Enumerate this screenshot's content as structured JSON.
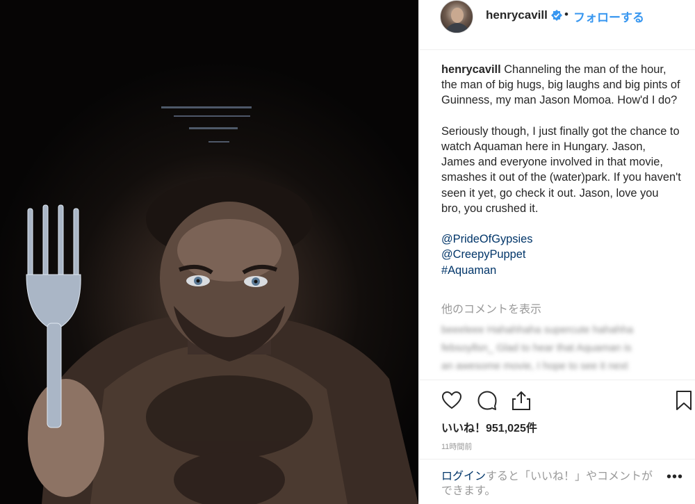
{
  "post": {
    "username": "henrycavill",
    "follow_label": "フォローする",
    "separator": "•",
    "caption_paragraphs": [
      "Channeling the man of the hour, the man of big hugs, big laughs and big pints of Guinness, my man Jason Momoa. How'd I do?",
      "Seriously though, I just finally got the chance to watch Aquaman here in Hungary. Jason, James and everyone involved in that movie, smashes it out of the (water)park. If you haven't seen it yet, go check it out. Jason, love you bro, you crushed it."
    ],
    "tags": [
      "@PrideOfGypsies",
      "@CreepyPuppet",
      "#Aquaman"
    ],
    "more_comments_label": "他のコメントを表示",
    "blurred_comments": [
      "beeeleee Hahahhaha supercute hahahha",
      "febsoyllsn_ Glad to hear that Aquaman is",
      "an awesome movie, I hope to see it next"
    ],
    "likes_label": "いいね！951,025件",
    "timestamp": "11時間前",
    "login_link": "ログイン",
    "login_rest": "すると「いいね！」やコメントができます。",
    "more_label": "•••"
  },
  "icons": {
    "heart": "heart-icon",
    "comment": "comment-icon",
    "share": "share-icon",
    "bookmark": "bookmark-icon",
    "verified": "verified-badge-icon"
  },
  "colors": {
    "link": "#003569",
    "follow": "#3897f0",
    "verified": "#3897f0",
    "muted": "#999999"
  }
}
